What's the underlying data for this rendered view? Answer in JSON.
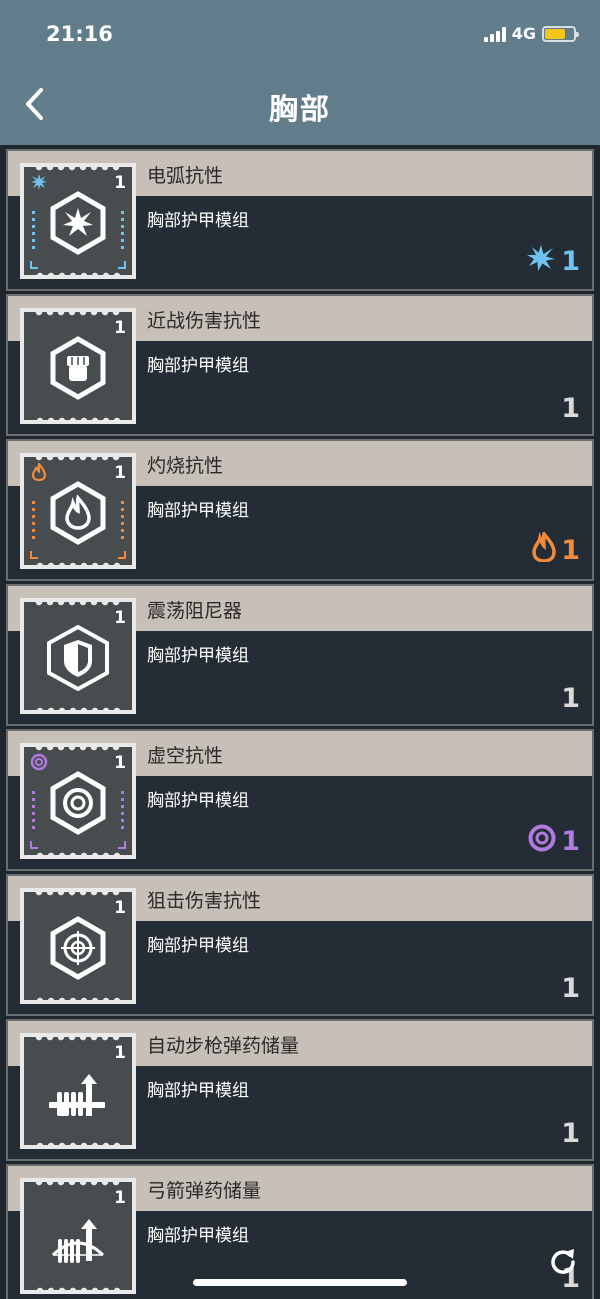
{
  "status_bar": {
    "time": "21:16",
    "network": "4G",
    "battery_level": 0.72
  },
  "header": {
    "title": "胸部",
    "back_icon": "chevron-left-icon"
  },
  "colors": {
    "header_bg": "#617d8c",
    "card_name_bg": "#c7c0b9",
    "card_body_bg": "#242d35",
    "arc": "#6ec3f0",
    "solar": "#f08a3c",
    "void": "#b07ae0",
    "neutral": "#d9d9d9"
  },
  "mods": [
    {
      "name": "电弧抗性",
      "subtitle": "胸部护甲模组",
      "level": "1",
      "cost": "1",
      "element": "arc",
      "icon": "arc-burst-icon"
    },
    {
      "name": "近战伤害抗性",
      "subtitle": "胸部护甲模组",
      "level": "1",
      "cost": "1",
      "element": "none",
      "icon": "fist-icon"
    },
    {
      "name": "灼烧抗性",
      "subtitle": "胸部护甲模组",
      "level": "1",
      "cost": "1",
      "element": "solar",
      "icon": "flame-icon"
    },
    {
      "name": "震荡阻尼器",
      "subtitle": "胸部护甲模组",
      "level": "1",
      "cost": "1",
      "element": "none",
      "icon": "shield-icon"
    },
    {
      "name": "虚空抗性",
      "subtitle": "胸部护甲模组",
      "level": "1",
      "cost": "1",
      "element": "void",
      "icon": "void-orb-icon"
    },
    {
      "name": "狙击伤害抗性",
      "subtitle": "胸部护甲模组",
      "level": "1",
      "cost": "1",
      "element": "none",
      "icon": "crosshair-icon"
    },
    {
      "name": "自动步枪弹药储量",
      "subtitle": "胸部护甲模组",
      "level": "1",
      "cost": "1",
      "element": "none",
      "icon": "auto-rifle-ammo-icon"
    },
    {
      "name": "弓箭弹药储量",
      "subtitle": "胸部护甲模组",
      "level": "1",
      "cost": "1",
      "element": "none",
      "icon": "bow-ammo-icon"
    }
  ],
  "footer": {
    "refresh_icon": "refresh-icon"
  }
}
